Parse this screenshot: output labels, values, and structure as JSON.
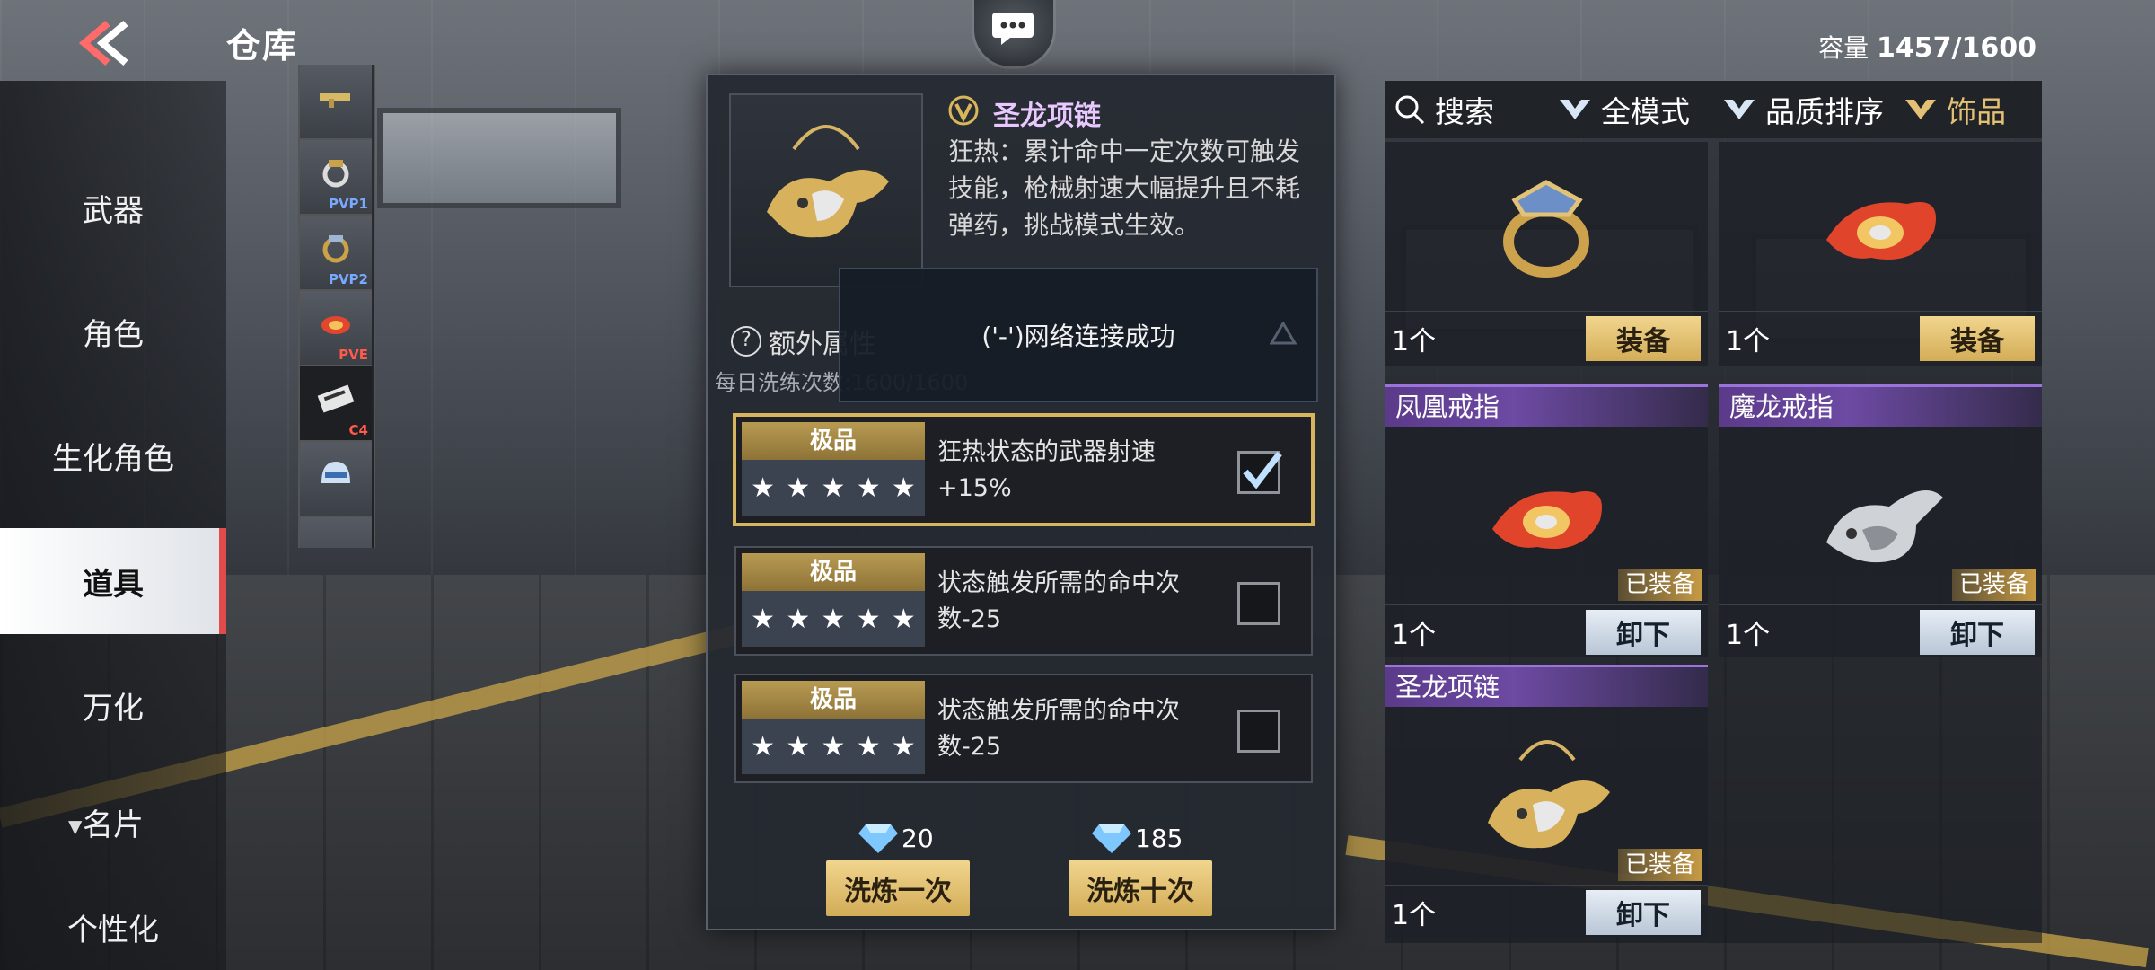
{
  "header": {
    "title": "仓库",
    "capacity_label": "容量",
    "capacity_value": "1457/1600"
  },
  "nav": {
    "items": [
      {
        "label": "武器"
      },
      {
        "label": "角色"
      },
      {
        "label": "生化角色"
      },
      {
        "label": "道具"
      },
      {
        "label": "万化"
      },
      {
        "label": "名片"
      },
      {
        "label": "个性化"
      }
    ],
    "active": "道具"
  },
  "thumbs": [
    {
      "tag": ""
    },
    {
      "tag": "PVP1"
    },
    {
      "tag": "PVP2"
    },
    {
      "tag": "PVE"
    },
    {
      "tag": "C4"
    },
    {
      "tag": ""
    },
    {
      "tag": ""
    }
  ],
  "detail": {
    "item_name": "圣龙项链",
    "description": "狂热：累计命中一定次数可触发技能，枪械射速大幅提升且不耗弹药，挑战模式生效。",
    "extra_attr_label": "额外属性",
    "daily_wash_label": "每日洗练次数:1600/1600",
    "attributes": [
      {
        "grade": "极品",
        "stars": 5,
        "text": "狂热状态的武器射速+15%",
        "checked": true
      },
      {
        "grade": "极品",
        "stars": 5,
        "text": "状态触发所需的命中次数-25",
        "checked": false
      },
      {
        "grade": "极品",
        "stars": 5,
        "text": "状态触发所需的命中次数-25",
        "checked": false
      }
    ],
    "wash_once": {
      "cost": "20",
      "label": "洗炼一次"
    },
    "wash_ten": {
      "cost": "185",
      "label": "洗炼十次"
    }
  },
  "toast": {
    "text": "('-')网络连接成功"
  },
  "filters": {
    "search": "搜索",
    "mode": "全模式",
    "sort": "品质排序",
    "category": "饰品"
  },
  "cards": [
    {
      "name": "",
      "count": "1个",
      "button": "装备",
      "equipped": ""
    },
    {
      "name": "",
      "count": "1个",
      "button": "装备",
      "equipped": ""
    },
    {
      "name": "凤凰戒指",
      "count": "1个",
      "button": "卸下",
      "equipped": "已装备"
    },
    {
      "name": "魔龙戒指",
      "count": "1个",
      "button": "卸下",
      "equipped": "已装备"
    },
    {
      "name": "圣龙项链",
      "count": "1个",
      "button": "卸下",
      "equipped": "已装备"
    }
  ],
  "colors": {
    "gold_button": "#e3c073",
    "purple_header": "#6d4aa3",
    "selected_border": "#d7b45e",
    "active_nav_accent": "#e24b4b"
  }
}
